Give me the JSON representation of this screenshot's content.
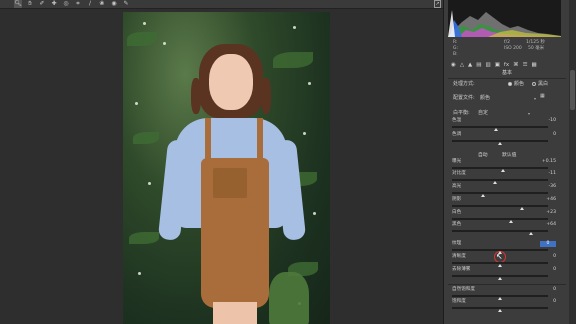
{
  "toolbar": {
    "icons": [
      "zoom-tool-icon",
      "hand-tool-icon",
      "white-balance-tool-icon",
      "color-sampler-icon",
      "targeted-adjustment-icon",
      "crop-tool-icon",
      "straighten-tool-icon",
      "spot-removal-icon",
      "red-eye-icon",
      "adjustment-brush-icon"
    ]
  },
  "camera_info": {
    "row1_label": "R:",
    "row2_label": "G:",
    "row3_label": "B:",
    "aperture": "f/2",
    "shutter": "1/125 秒",
    "iso": "ISO 200",
    "focal": "50 毫米"
  },
  "panel": {
    "section_title": "基本",
    "treatment_label": "处理方式:",
    "treatment_color": "颜色",
    "treatment_bw": "黑白",
    "profile_label": "配置文件:",
    "profile_value": "颜色",
    "wb_label": "白平衡:",
    "wb_value": "自定",
    "auto_label": "自动",
    "default_label": "默认值"
  },
  "sliders": [
    {
      "id": "temperature",
      "label": "色温",
      "value": "-10",
      "level": 0.46
    },
    {
      "id": "tint",
      "label": "色调",
      "value": "0",
      "level": 0.5
    },
    {
      "id": "exposure",
      "label": "曝光",
      "value": "+0.15",
      "level": 0.53
    },
    {
      "id": "contrast",
      "label": "对比度",
      "value": "-11",
      "level": 0.45
    },
    {
      "id": "highlights",
      "label": "高光",
      "value": "-36",
      "level": 0.32
    },
    {
      "id": "shadows",
      "label": "阴影",
      "value": "+46",
      "level": 0.73
    },
    {
      "id": "whites",
      "label": "白色",
      "value": "+23",
      "level": 0.61
    },
    {
      "id": "blacks",
      "label": "黑色",
      "value": "+64",
      "level": 0.82
    },
    {
      "id": "texture",
      "label": "纹理",
      "value": "0",
      "level": 0.5
    },
    {
      "id": "clarity",
      "label": "清晰度",
      "value": "0",
      "level": 0.5
    },
    {
      "id": "dehaze",
      "label": "去除薄雾",
      "value": "0",
      "level": 0.5
    },
    {
      "id": "vibrance",
      "label": "自然饱和度",
      "value": "0",
      "level": 0.5
    },
    {
      "id": "saturation",
      "label": "饱和度",
      "value": "0",
      "level": 0.5
    }
  ]
}
